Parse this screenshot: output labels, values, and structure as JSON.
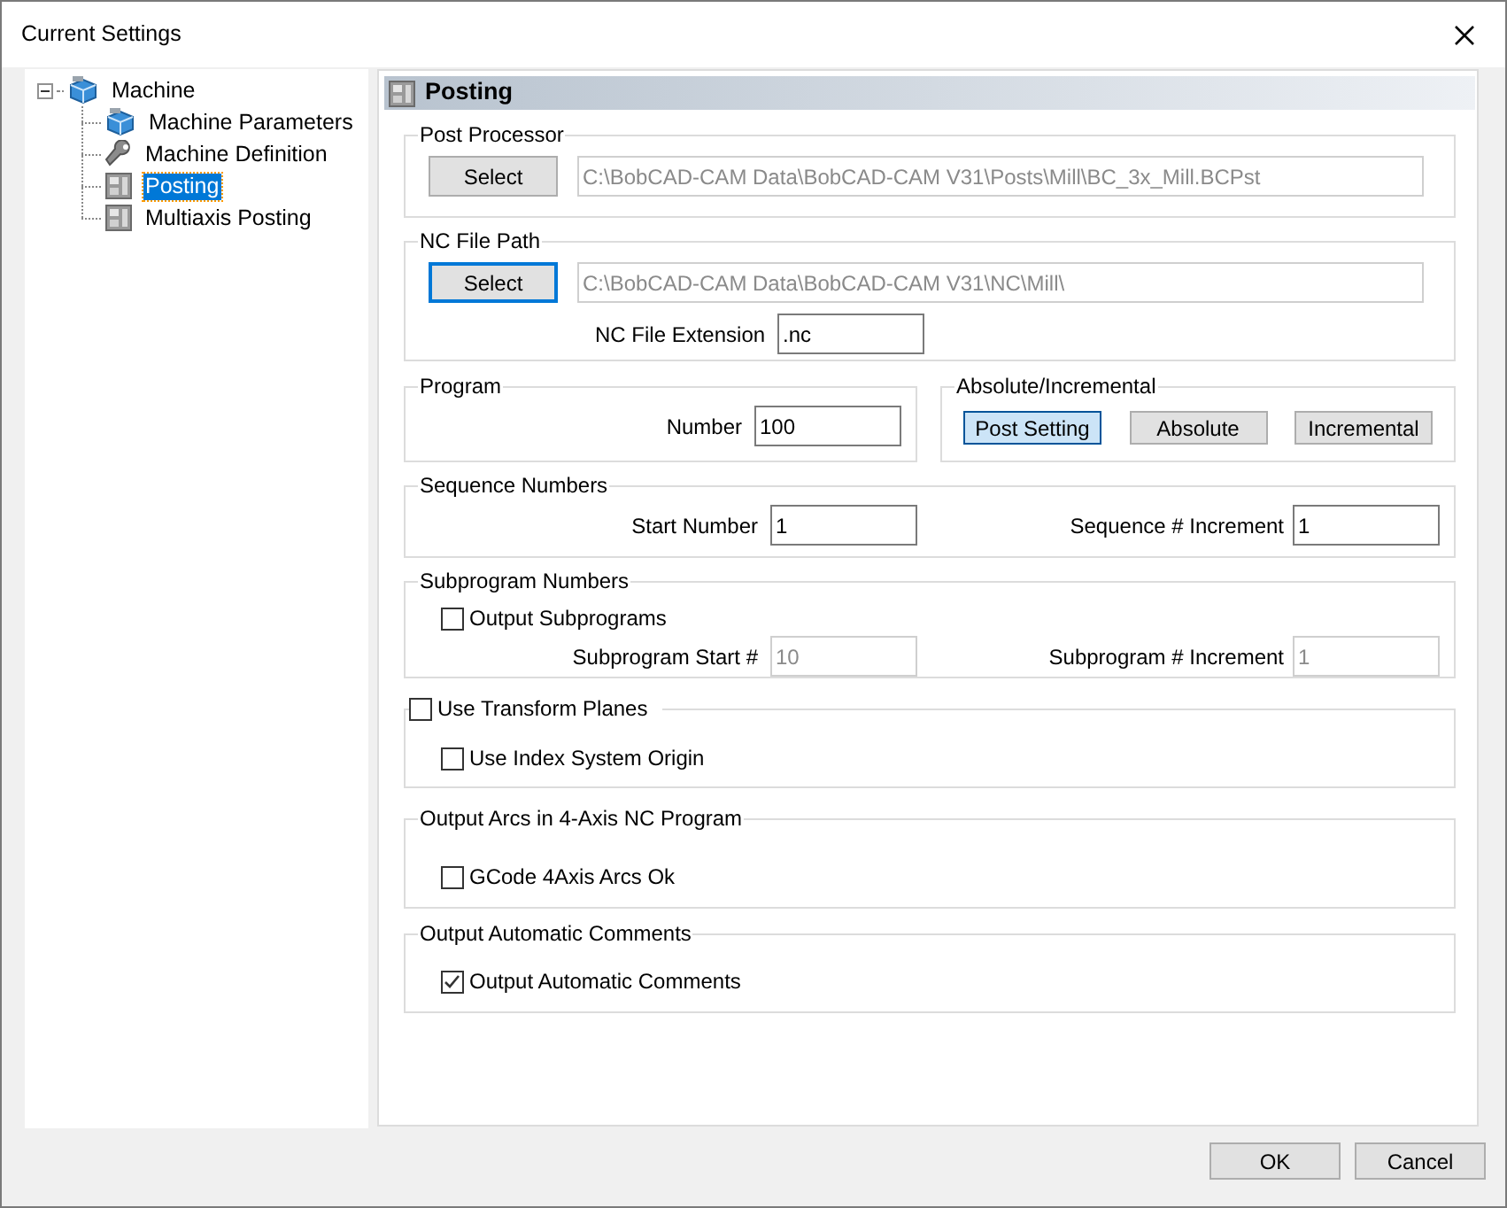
{
  "window": {
    "title": "Current Settings"
  },
  "tree": [
    {
      "label": "Machine",
      "kind": "machine",
      "expanded": true,
      "selected": false,
      "children": [
        {
          "label": "Machine Parameters",
          "kind": "machine",
          "selected": false
        },
        {
          "label": "Machine Definition",
          "kind": "wrench",
          "selected": false
        },
        {
          "label": "Posting",
          "kind": "grid",
          "selected": true
        },
        {
          "label": "Multiaxis Posting",
          "kind": "grid",
          "selected": false
        }
      ]
    }
  ],
  "panel": {
    "title": "Posting",
    "post_processor": {
      "legend": "Post Processor",
      "button": {
        "label": "Select",
        "focused": false
      },
      "path": {
        "value": "C:\\BobCAD-CAM Data\\BobCAD-CAM V31\\Posts\\Mill\\BC_3x_Mill.BCPst",
        "disabled": true
      }
    },
    "nc_file_path": {
      "legend": "NC File Path",
      "button": {
        "label": "Select",
        "focused": true
      },
      "path": {
        "value": "C:\\BobCAD-CAM Data\\BobCAD-CAM V31\\NC\\Mill\\",
        "disabled": true
      },
      "extension_label": "NC File Extension",
      "extension": {
        "value": ".nc",
        "disabled": false
      }
    },
    "program": {
      "legend": "Program",
      "number_label": "Number",
      "number": {
        "value": "100",
        "disabled": false
      }
    },
    "absolute_incremental": {
      "legend": "Absolute/Incremental",
      "options": [
        {
          "label": "Post Setting",
          "selected": true
        },
        {
          "label": "Absolute",
          "selected": false
        },
        {
          "label": "Incremental",
          "selected": false
        }
      ]
    },
    "sequence_numbers": {
      "legend": "Sequence Numbers",
      "start_label": "Start Number",
      "start": {
        "value": "1",
        "disabled": false
      },
      "increment_label": "Sequence # Increment",
      "increment": {
        "value": "1",
        "disabled": false
      }
    },
    "subprogram_numbers": {
      "legend": "Subprogram Numbers",
      "output": {
        "label": "Output Subprograms",
        "checked": false
      },
      "start_label": "Subprogram Start #",
      "start": {
        "value": "10",
        "disabled": true
      },
      "increment_label": "Subprogram # Increment",
      "increment": {
        "value": "1",
        "disabled": true
      }
    },
    "transform_planes": {
      "label": "Use Transform Planes",
      "checked": false,
      "index_origin": {
        "label": "Use Index System Origin",
        "checked": false
      }
    },
    "arcs": {
      "legend": "Output Arcs in 4-Axis NC Program",
      "option": {
        "label": "GCode 4Axis Arcs Ok",
        "checked": false
      }
    },
    "comments": {
      "legend": "Output Automatic Comments",
      "option": {
        "label": "Output Automatic Comments",
        "checked": true
      }
    }
  },
  "buttons": [
    {
      "label": "OK"
    },
    {
      "label": "Cancel"
    }
  ]
}
